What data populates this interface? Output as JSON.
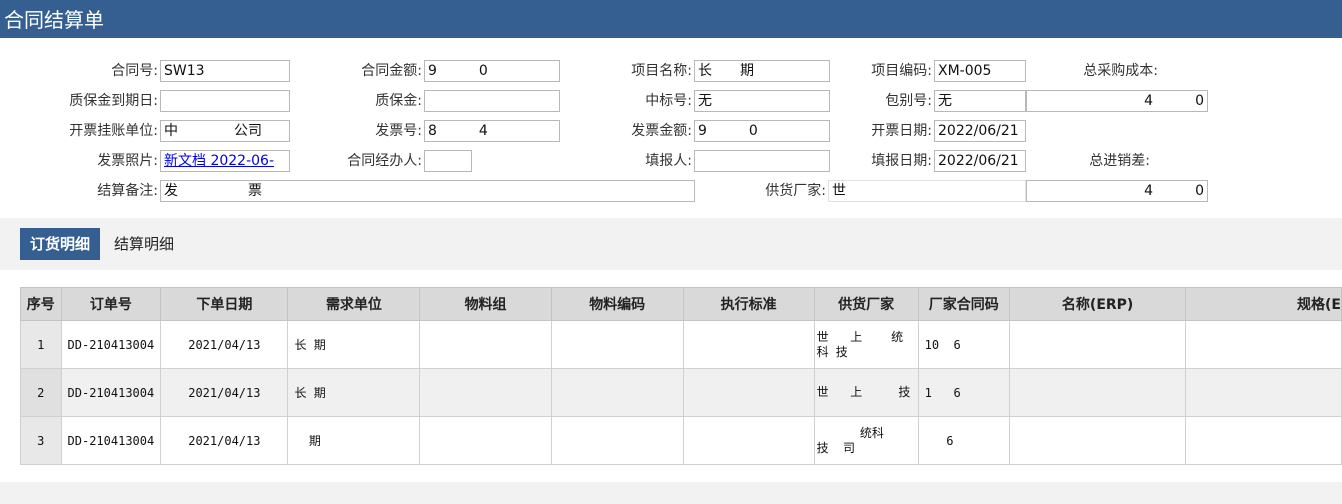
{
  "title": "合同结算单",
  "form": {
    "contract_no": {
      "label": "合同号:",
      "value": "SW13"
    },
    "contract_amount": {
      "label": "合同金额:",
      "value": "9   0"
    },
    "project_name": {
      "label": "项目名称:",
      "value": "长  期"
    },
    "project_code": {
      "label": "项目编码:",
      "value": "XM-005"
    },
    "total_purchase_cost": {
      "label": "总采购成本:",
      "value": "4   0"
    },
    "deposit_due_date": {
      "label": "质保金到期日:",
      "value": ""
    },
    "deposit": {
      "label": "质保金:",
      "value": ""
    },
    "bid_no": {
      "label": "中标号:",
      "value": "无"
    },
    "package_no": {
      "label": "包别号:",
      "value": "无"
    },
    "invoice_unit": {
      "label": "开票挂账单位:",
      "value": "中    公司"
    },
    "invoice_no": {
      "label": "发票号:",
      "value": "8   4"
    },
    "invoice_amount": {
      "label": "发票金额:",
      "value": "9   0"
    },
    "invoice_date": {
      "label": "开票日期:",
      "value": "2022/06/21"
    },
    "invoice_photo": {
      "label": "发票照片:",
      "value": "新文档 2022-06-"
    },
    "contract_handler": {
      "label": "合同经办人:",
      "value": ""
    },
    "filler": {
      "label": "填报人:",
      "value": ""
    },
    "fill_date": {
      "label": "填报日期:",
      "value": "2022/06/21"
    },
    "total_margin": {
      "label": "总进销差:",
      "value": "4   0"
    },
    "settlement_note": {
      "label": "结算备注:",
      "value": "发     票"
    },
    "supplier": {
      "label": "供货厂家:",
      "value": "世"
    }
  },
  "tabs": [
    {
      "label": "订货明细",
      "active": true
    },
    {
      "label": "结算明细",
      "active": false
    }
  ],
  "grid": {
    "columns": [
      "序号",
      "订单号",
      "下单日期",
      "需求单位",
      "物料组",
      "物料编码",
      "执行标准",
      "供货厂家",
      "厂家合同码",
      "名称(ERP)",
      "规格(E"
    ],
    "rows": [
      {
        "idx": "1",
        "order_no": "DD-210413004",
        "date": "2021/04/13",
        "unit": "长 期",
        "supplier": "世   上    统科 技",
        "factory_code": "10  6"
      },
      {
        "idx": "2",
        "order_no": "DD-210413004",
        "date": "2021/04/13",
        "unit": "长 期",
        "supplier": "世   上     技",
        "factory_code": "1   6"
      },
      {
        "idx": "3",
        "order_no": "DD-210413004",
        "date": "2021/04/13",
        "unit": "  期",
        "supplier": "      统科 技  司",
        "factory_code": "   6"
      }
    ]
  }
}
